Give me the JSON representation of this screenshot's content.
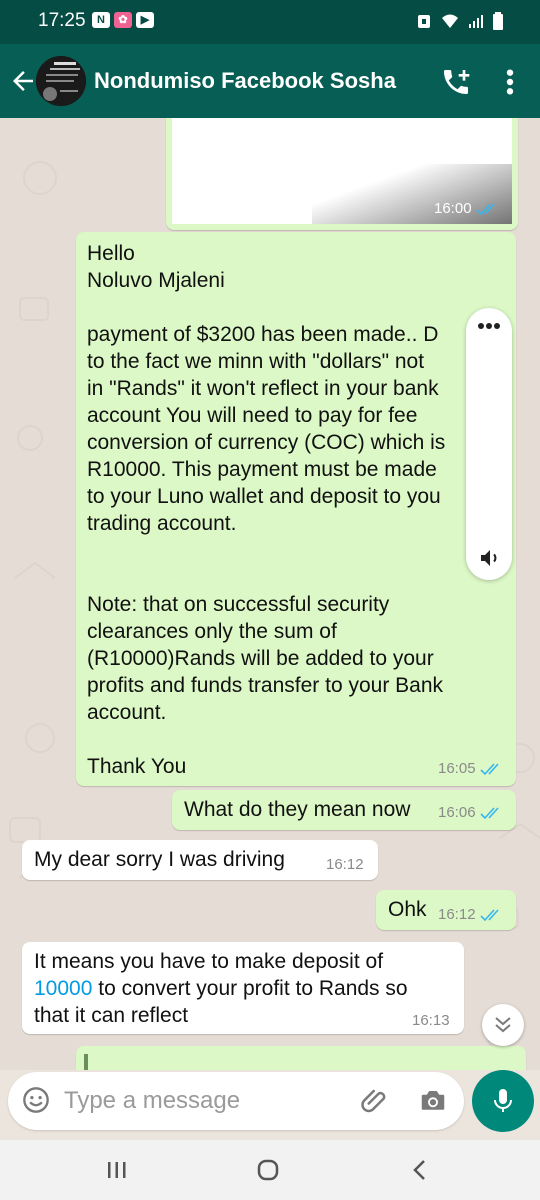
{
  "status_bar": {
    "time": "17:25"
  },
  "header": {
    "title": "Nondumiso Facebook Sosha"
  },
  "messages": [
    {
      "time": "16:00"
    },
    {
      "text": "Hello\nNoluvo Mjaleni\n\npayment of $3200 has been made.. D\nto the fact we minn with \"dollars\" not\nin \"Rands\" it won't reflect in your bank\naccount You will need to pay for fee\nconversion of currency (COC) which is\nR10000. This payment must be made\nto your Luno wallet and deposit to you\ntrading account.\n\n\nNote: that on successful security\nclearances only the sum of\n(R10000)Rands will be added to your\nprofits and funds transfer to your Bank\naccount.\n\nThank You",
      "time": "16:05"
    },
    {
      "text": "What do they mean now",
      "time": "16:06"
    },
    {
      "text": "My dear sorry I was driving",
      "time": "16:12"
    },
    {
      "text": "Ohk",
      "time": "16:12"
    },
    {
      "text_line1": "It means you have to make deposit of",
      "link": "10000",
      "text_rest": " to convert your profit to Rands so\nthat it can reflect",
      "time": "16:13"
    }
  ],
  "input": {
    "placeholder": "Type a message"
  },
  "colors": {
    "header": "#075e54",
    "outgoing": "#dcf8c6",
    "accent": "#00897b",
    "tick": "#34b7f1",
    "link": "#039be5"
  }
}
